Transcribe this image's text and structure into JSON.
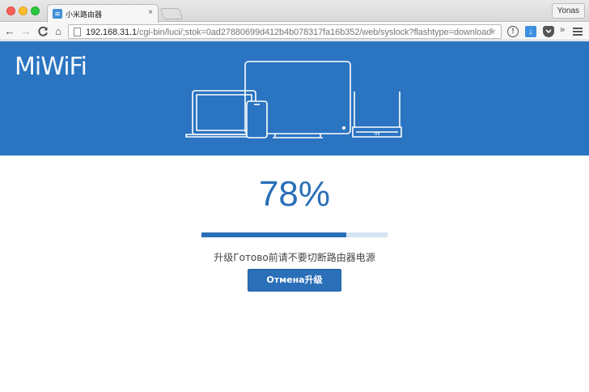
{
  "browser": {
    "tab_title": "小米路由器",
    "tab_close": "×",
    "profile_name": "Yonas",
    "url_host": "192.168.31.1",
    "url_path": "/cgi-bin/luci/;stok=0ad27880699d412b4b078317fa16b352/web/syslock?flashtype=download",
    "star_glyph": "★",
    "ext_info_glyph": "!",
    "ext_download_glyph": "↓",
    "ext_more_glyph": "»",
    "icons": {
      "back": "←",
      "forward": "→",
      "reload": "C",
      "home": "⌂"
    }
  },
  "page": {
    "logo": "MiWiFi",
    "router_brand_mark": "mi",
    "progress_percent": 78,
    "progress_label": "78%",
    "status_text": "升级Готово前请不要切断路由器电源",
    "cancel_button": "Отмена升级"
  },
  "colors": {
    "brand_blue": "#2a74c1",
    "accent_blue": "#2a6fb8",
    "track": "#d5e3f2"
  }
}
